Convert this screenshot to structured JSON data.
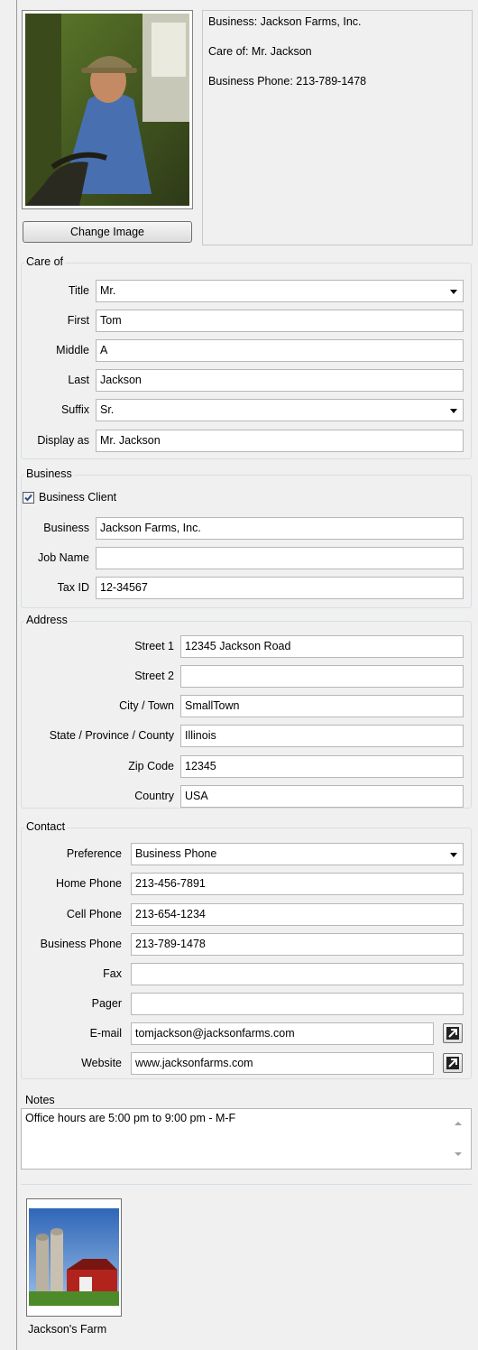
{
  "summary": {
    "business": "Business: Jackson Farms, Inc.",
    "care_of": "Care of: Mr. Jackson",
    "business_phone": "Business Phone: 213-789-1478"
  },
  "photo": {
    "button_label": "Change Image"
  },
  "care_of": {
    "title": "Care of",
    "title_label": "Title",
    "title_value": "Mr.",
    "first_label": "First",
    "first_value": "Tom",
    "middle_label": "Middle",
    "middle_value": "A",
    "last_label": "Last",
    "last_value": "Jackson",
    "suffix_label": "Suffix",
    "suffix_value": "Sr.",
    "display_label": "Display as",
    "display_value": "Mr. Jackson"
  },
  "business": {
    "title": "Business",
    "client_label": "Business Client",
    "client_checked": true,
    "business_label": "Business",
    "business_value": "Jackson Farms, Inc.",
    "job_label": "Job Name",
    "job_value": "",
    "tax_label": "Tax ID",
    "tax_value": "12-34567"
  },
  "address": {
    "title": "Address",
    "street1_label": "Street 1",
    "street1_value": "12345 Jackson Road",
    "street2_label": "Street 2",
    "street2_value": "",
    "city_label": "City / Town",
    "city_value": "SmallTown",
    "state_label": "State / Province / County",
    "state_value": "Illinois",
    "zip_label": "Zip Code",
    "zip_value": "12345",
    "country_label": "Country",
    "country_value": "USA"
  },
  "contact": {
    "title": "Contact",
    "preference_label": "Preference",
    "preference_value": "Business Phone",
    "home_label": "Home Phone",
    "home_value": "213-456-7891",
    "cell_label": "Cell Phone",
    "cell_value": "213-654-1234",
    "business_phone_label": "Business Phone",
    "business_phone_value": "213-789-1478",
    "fax_label": "Fax",
    "fax_value": "",
    "pager_label": "Pager",
    "pager_value": "",
    "email_label": "E-mail",
    "email_value": "tomjackson@jacksonfarms.com",
    "website_label": "Website",
    "website_value": "www.jacksonfarms.com"
  },
  "notes": {
    "title": "Notes",
    "text": "Office hours are 5:00 pm to 9:00 pm - M-F"
  },
  "attachments": {
    "items": [
      {
        "label": "Jackson's Farm"
      }
    ]
  },
  "colors": {
    "background": "#f0f0f0",
    "border": "#b7b7b7",
    "group_border": "#d5dfe5"
  }
}
